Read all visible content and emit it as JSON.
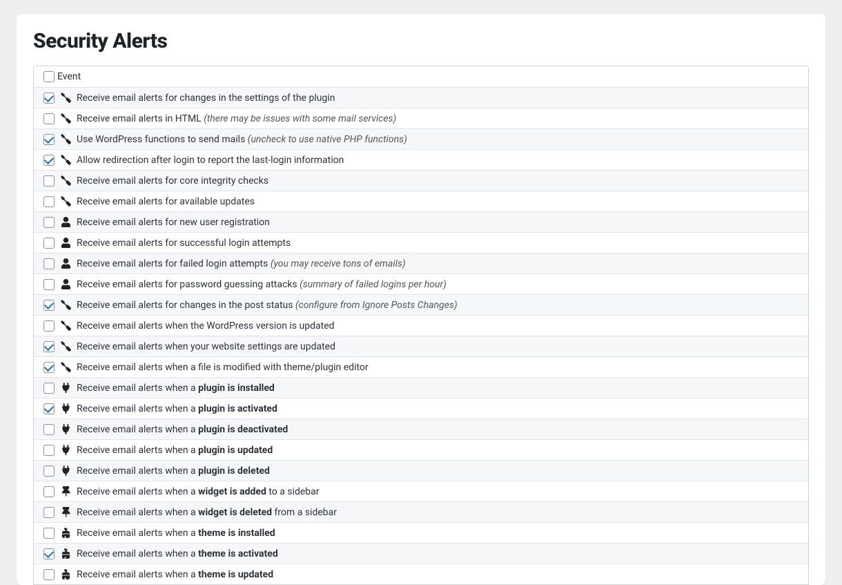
{
  "title": "Security Alerts",
  "table_header": "Event",
  "rows": [
    {
      "checked": true,
      "icon": "wrench",
      "segments": [
        [
          "Receive email alerts for changes in the settings of the plugin",
          ""
        ]
      ]
    },
    {
      "checked": false,
      "icon": "wrench",
      "segments": [
        [
          "Receive email alerts in HTML ",
          ""
        ],
        [
          "(there may be issues with some mail services)",
          "italic"
        ]
      ]
    },
    {
      "checked": true,
      "icon": "wrench",
      "segments": [
        [
          "Use WordPress functions to send mails ",
          ""
        ],
        [
          "(uncheck to use native PHP functions)",
          "italic"
        ]
      ]
    },
    {
      "checked": true,
      "icon": "wrench",
      "segments": [
        [
          "Allow redirection after login to report the last-login information",
          ""
        ]
      ]
    },
    {
      "checked": false,
      "icon": "wrench",
      "segments": [
        [
          "Receive email alerts for core integrity checks",
          ""
        ]
      ]
    },
    {
      "checked": false,
      "icon": "wrench",
      "segments": [
        [
          "Receive email alerts for available updates",
          ""
        ]
      ]
    },
    {
      "checked": false,
      "icon": "user",
      "segments": [
        [
          "Receive email alerts for new user registration",
          ""
        ]
      ]
    },
    {
      "checked": false,
      "icon": "user",
      "segments": [
        [
          "Receive email alerts for successful login attempts",
          ""
        ]
      ]
    },
    {
      "checked": false,
      "icon": "user",
      "segments": [
        [
          "Receive email alerts for failed login attempts ",
          ""
        ],
        [
          "(you may receive tons of emails)",
          "italic"
        ]
      ]
    },
    {
      "checked": false,
      "icon": "user",
      "segments": [
        [
          "Receive email alerts for password guessing attacks ",
          ""
        ],
        [
          "(summary of failed logins per hour)",
          "italic"
        ]
      ]
    },
    {
      "checked": true,
      "icon": "wrench",
      "segments": [
        [
          "Receive email alerts for changes in the post status ",
          ""
        ],
        [
          "(configure from Ignore Posts Changes)",
          "italic"
        ]
      ]
    },
    {
      "checked": false,
      "icon": "wrench",
      "segments": [
        [
          "Receive email alerts when the WordPress version is updated",
          ""
        ]
      ]
    },
    {
      "checked": true,
      "icon": "wrench",
      "segments": [
        [
          "Receive email alerts when your website settings are updated",
          ""
        ]
      ]
    },
    {
      "checked": true,
      "icon": "wrench",
      "segments": [
        [
          "Receive email alerts when a file is modified with theme/plugin editor",
          ""
        ]
      ]
    },
    {
      "checked": false,
      "icon": "plug",
      "segments": [
        [
          "Receive email alerts when a ",
          ""
        ],
        [
          "plugin is installed",
          "bold"
        ]
      ]
    },
    {
      "checked": true,
      "icon": "plug",
      "segments": [
        [
          "Receive email alerts when a ",
          ""
        ],
        [
          "plugin is activated",
          "bold"
        ]
      ]
    },
    {
      "checked": false,
      "icon": "plug",
      "segments": [
        [
          "Receive email alerts when a ",
          ""
        ],
        [
          "plugin is deactivated",
          "bold"
        ]
      ]
    },
    {
      "checked": false,
      "icon": "plug",
      "segments": [
        [
          "Receive email alerts when a ",
          ""
        ],
        [
          "plugin is updated",
          "bold"
        ]
      ]
    },
    {
      "checked": false,
      "icon": "plug",
      "segments": [
        [
          "Receive email alerts when a ",
          ""
        ],
        [
          "plugin is deleted",
          "bold"
        ]
      ]
    },
    {
      "checked": false,
      "icon": "pin",
      "segments": [
        [
          "Receive email alerts when a ",
          ""
        ],
        [
          "widget is added",
          "bold"
        ],
        [
          " to a sidebar",
          ""
        ]
      ]
    },
    {
      "checked": false,
      "icon": "pin",
      "segments": [
        [
          "Receive email alerts when a ",
          ""
        ],
        [
          "widget is deleted",
          "bold"
        ],
        [
          " from a sidebar",
          ""
        ]
      ]
    },
    {
      "checked": false,
      "icon": "brush",
      "segments": [
        [
          "Receive email alerts when a ",
          ""
        ],
        [
          "theme is installed",
          "bold"
        ]
      ]
    },
    {
      "checked": true,
      "icon": "brush",
      "segments": [
        [
          "Receive email alerts when a ",
          ""
        ],
        [
          "theme is activated",
          "bold"
        ]
      ]
    },
    {
      "checked": false,
      "icon": "brush",
      "segments": [
        [
          "Receive email alerts when a ",
          ""
        ],
        [
          "theme is updated",
          "bold"
        ]
      ]
    }
  ]
}
